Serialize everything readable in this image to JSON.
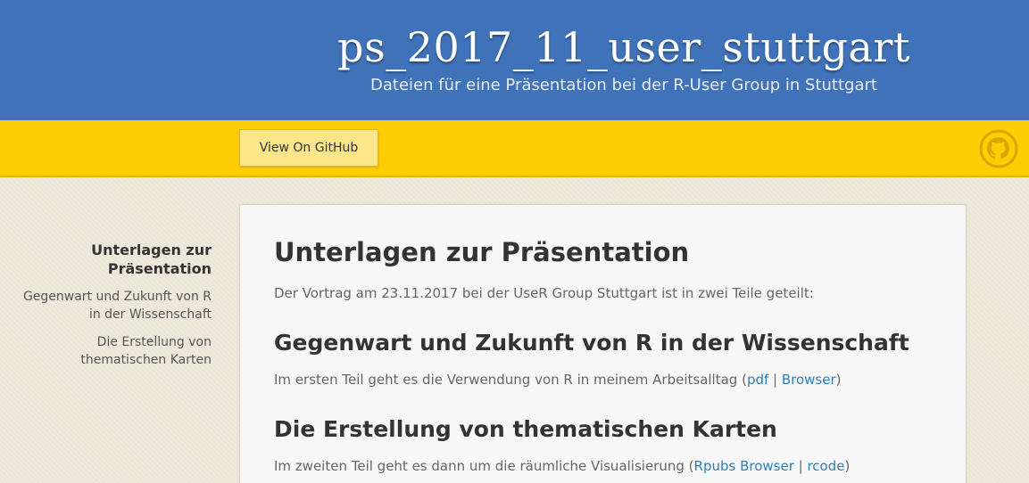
{
  "header": {
    "title": "ps_2017_11_user_stuttgart",
    "subtitle": "Dateien für eine Präsentation bei der R-User Group in Stuttgart"
  },
  "banner": {
    "github_button_label": "View On GitHub",
    "logo_icon": "github-octocat-icon"
  },
  "sidebar": {
    "title_line1": "Unterlagen zur",
    "title_line2": "Präsentation",
    "items": [
      {
        "line1": "Gegenwart und Zukunft von R",
        "line2": "in der Wissenschaft"
      },
      {
        "line1": "Die Erstellung von",
        "line2": "thematischen Karten"
      }
    ]
  },
  "main": {
    "heading": "Unterlagen zur Präsentation",
    "intro": "Der Vortrag am 23.11.2017 bei der UseR Group Stuttgart ist in zwei Teile geteilt:",
    "section1": {
      "heading": "Gegenwart und Zukunft von R in der Wissenschaft",
      "text_before": "Im ersten Teil geht es die Verwendung von R in meinem Arbeitsalltag (",
      "link1": "pdf",
      "sep": " | ",
      "link2": "Browser",
      "text_after": ")"
    },
    "section2": {
      "heading": "Die Erstellung von thematischen Karten",
      "text_before": "Im zweiten Teil geht es dann um die räumliche Visualisierung (",
      "link1": "Rpubs Browser",
      "sep": " | ",
      "link2": "rcode",
      "text_after": ")"
    }
  },
  "colors": {
    "header_bg": "#3f72b8",
    "banner_bg": "#fecd04",
    "link": "#2f7fb8"
  }
}
